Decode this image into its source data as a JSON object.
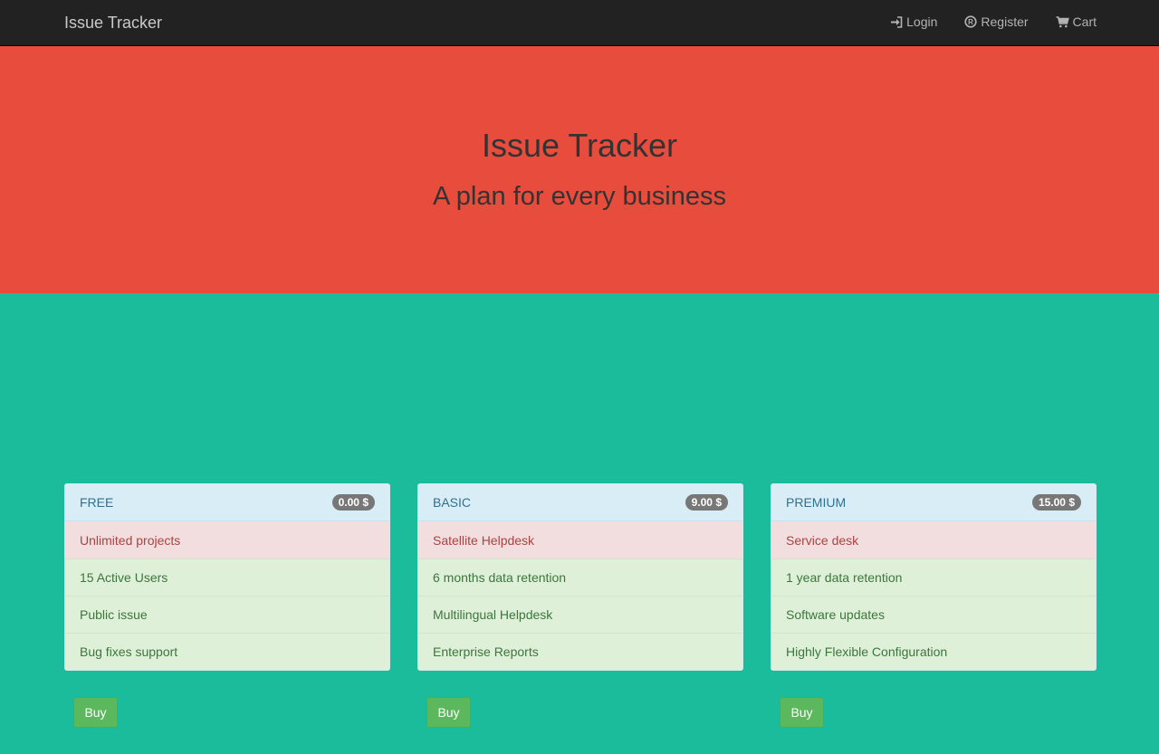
{
  "navbar": {
    "brand": "Issue Tracker",
    "links": [
      {
        "label": "Login",
        "icon": "login-icon"
      },
      {
        "label": "Register",
        "icon": "register-icon"
      },
      {
        "label": "Cart",
        "icon": "cart-icon"
      }
    ]
  },
  "hero": {
    "title": "Issue Tracker",
    "subtitle": "A plan for every business"
  },
  "colors": {
    "navbar": "#222222",
    "hero": "#e74c3c",
    "page": "#1abc9c",
    "buy_button": "#5cb85c"
  },
  "plans": [
    {
      "name": "FREE",
      "price": "0.00 $",
      "highlight": "Unlimited projects",
      "features": [
        "15 Active Users",
        "Public issue",
        "Bug fixes support"
      ],
      "buy_label": "Buy"
    },
    {
      "name": "BASIC",
      "price": "9.00 $",
      "highlight": "Satellite Helpdesk",
      "features": [
        "6 months data retention",
        "Multilingual Helpdesk",
        "Enterprise Reports"
      ],
      "buy_label": "Buy"
    },
    {
      "name": "PREMIUM",
      "price": "15.00 $",
      "highlight": "Service desk",
      "features": [
        "1 year data retention",
        "Software updates",
        "Highly Flexible Configuration"
      ],
      "buy_label": "Buy"
    }
  ]
}
